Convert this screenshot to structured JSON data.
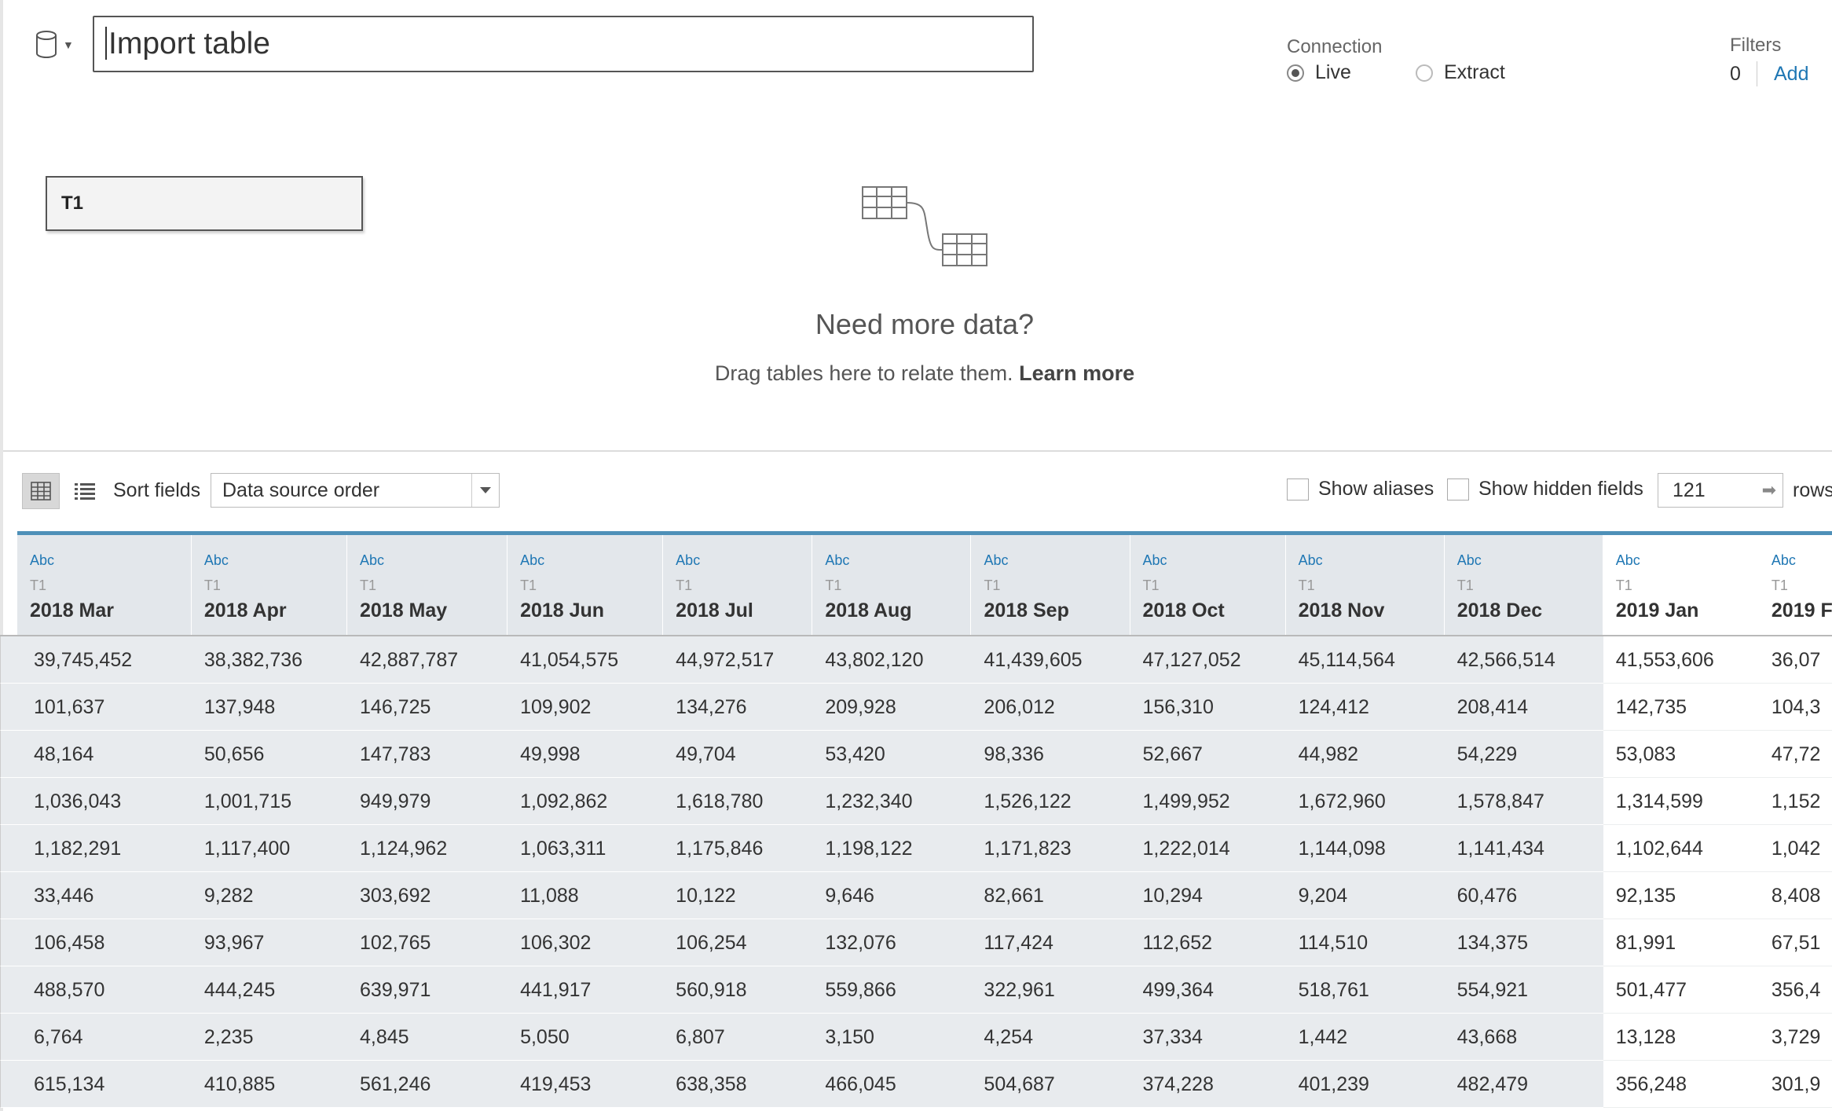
{
  "header": {
    "datasource_name": "Import table",
    "connection_label": "Connection",
    "connection_options": [
      "Live",
      "Extract"
    ],
    "connection_selected": "Live",
    "filters_label": "Filters",
    "filters_count": "0",
    "filters_add": "Add"
  },
  "canvas": {
    "table_name": "T1",
    "need_more_title": "Need more data?",
    "need_more_text": "Drag tables here to relate them.",
    "learn_more": "Learn more"
  },
  "toolbar": {
    "sort_label": "Sort fields",
    "sort_value": "Data source order",
    "show_aliases": "Show aliases",
    "show_hidden": "Show hidden fields",
    "rows_value": "121",
    "rows_label": "rows"
  },
  "grid": {
    "columns": [
      {
        "type": "Abc",
        "table": "T1",
        "name": "2018 Mar"
      },
      {
        "type": "Abc",
        "table": "T1",
        "name": "2018 Apr"
      },
      {
        "type": "Abc",
        "table": "T1",
        "name": "2018 May"
      },
      {
        "type": "Abc",
        "table": "T1",
        "name": "2018 Jun"
      },
      {
        "type": "Abc",
        "table": "T1",
        "name": "2018 Jul"
      },
      {
        "type": "Abc",
        "table": "T1",
        "name": "2018 Aug"
      },
      {
        "type": "Abc",
        "table": "T1",
        "name": "2018 Sep"
      },
      {
        "type": "Abc",
        "table": "T1",
        "name": "2018 Oct"
      },
      {
        "type": "Abc",
        "table": "T1",
        "name": "2018 Nov"
      },
      {
        "type": "Abc",
        "table": "T1",
        "name": "2018 Dec"
      },
      {
        "type": "Abc",
        "table": "T1",
        "name": "2019 Jan"
      },
      {
        "type": "Abc",
        "table": "T1",
        "name": "2019 F"
      }
    ],
    "rows": [
      [
        "39,745,452",
        "38,382,736",
        "42,887,787",
        "41,054,575",
        "44,972,517",
        "43,802,120",
        "41,439,605",
        "47,127,052",
        "45,114,564",
        "42,566,514",
        "41,553,606",
        "36,07"
      ],
      [
        "101,637",
        "137,948",
        "146,725",
        "109,902",
        "134,276",
        "209,928",
        "206,012",
        "156,310",
        "124,412",
        "208,414",
        "142,735",
        "104,3"
      ],
      [
        "48,164",
        "50,656",
        "147,783",
        "49,998",
        "49,704",
        "53,420",
        "98,336",
        "52,667",
        "44,982",
        "54,229",
        "53,083",
        "47,72"
      ],
      [
        "1,036,043",
        "1,001,715",
        "949,979",
        "1,092,862",
        "1,618,780",
        "1,232,340",
        "1,526,122",
        "1,499,952",
        "1,672,960",
        "1,578,847",
        "1,314,599",
        "1,152"
      ],
      [
        "1,182,291",
        "1,117,400",
        "1,124,962",
        "1,063,311",
        "1,175,846",
        "1,198,122",
        "1,171,823",
        "1,222,014",
        "1,144,098",
        "1,141,434",
        "1,102,644",
        "1,042"
      ],
      [
        "33,446",
        "9,282",
        "303,692",
        "11,088",
        "10,122",
        "9,646",
        "82,661",
        "10,294",
        "9,204",
        "60,476",
        "92,135",
        "8,408"
      ],
      [
        "106,458",
        "93,967",
        "102,765",
        "106,302",
        "106,254",
        "132,076",
        "117,424",
        "112,652",
        "114,510",
        "134,375",
        "81,991",
        "67,51"
      ],
      [
        "488,570",
        "444,245",
        "639,971",
        "441,917",
        "560,918",
        "559,866",
        "322,961",
        "499,364",
        "518,761",
        "554,921",
        "501,477",
        "356,4"
      ],
      [
        "6,764",
        "2,235",
        "4,845",
        "5,050",
        "6,807",
        "3,150",
        "4,254",
        "37,334",
        "1,442",
        "43,668",
        "13,128",
        "3,729"
      ],
      [
        "615,134",
        "410,885",
        "561,246",
        "419,453",
        "638,358",
        "466,045",
        "504,687",
        "374,228",
        "401,239",
        "482,479",
        "356,248",
        "301,9"
      ]
    ]
  },
  "colors": {
    "accent": "#1f77b4",
    "grid_header_bar": "#4e90b8",
    "selected_column_bg": "#e8ebee"
  }
}
